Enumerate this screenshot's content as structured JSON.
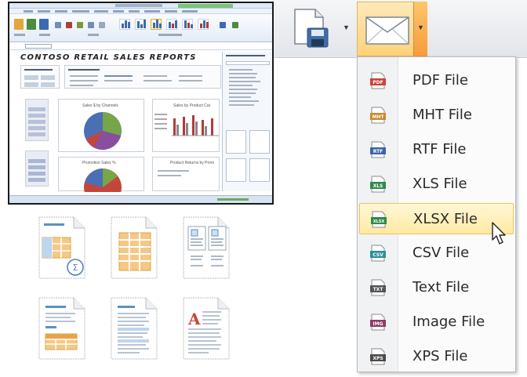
{
  "spreadsheet": {
    "report_title": "CONTOSO RETAIL SALES REPORTS",
    "chart1_title": "Sales $ by Channels",
    "chart2_title": "Sales by Product Cat",
    "chart3_title": "Promotion Sales %",
    "chart4_title": "Product Returns by Prom"
  },
  "toolbar": {
    "save_icon": "save-document-icon",
    "email_icon": "envelope-icon",
    "dropdown_icon": "chevron-down-icon"
  },
  "export_menu": {
    "items": [
      {
        "label": "PDF File",
        "badge": "PDF",
        "color": "#c8443a"
      },
      {
        "label": "MHT File",
        "badge": "MHT",
        "color": "#c98a2e"
      },
      {
        "label": "RTF File",
        "badge": "RTF",
        "color": "#3b64a8"
      },
      {
        "label": "XLS File",
        "badge": "XLS",
        "color": "#2f8a4a"
      },
      {
        "label": "XLSX File",
        "badge": "XLSX",
        "color": "#2f8a4a"
      },
      {
        "label": "CSV File",
        "badge": "CSV",
        "color": "#2b8f9c"
      },
      {
        "label": "Text File",
        "badge": "TXT",
        "color": "#555555"
      },
      {
        "label": "Image File",
        "badge": "IMG",
        "color": "#8a3d6a"
      },
      {
        "label": "XPS File",
        "badge": "XPS",
        "color": "#4a4a4a"
      }
    ],
    "hovered_index": 4
  },
  "doc_icons": [
    "spreadsheet-sum-doc-icon",
    "grid-table-doc-icon",
    "labels-doc-icon",
    "report-table-doc-icon",
    "text-columns-doc-icon",
    "letter-doc-icon"
  ]
}
